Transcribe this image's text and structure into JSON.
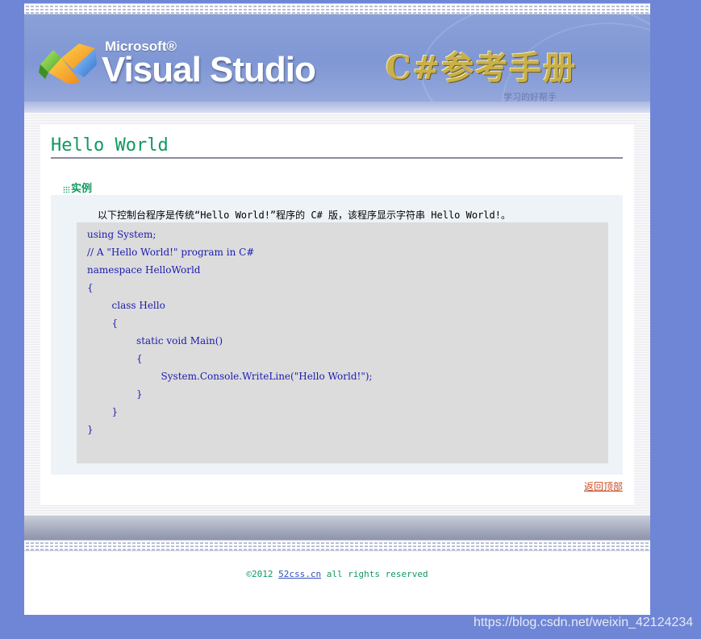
{
  "header": {
    "ms_label": "Microsoft®",
    "product_label": "Visual Studio",
    "manual_title": "C#参考手册",
    "tagline": "学习的好帮手"
  },
  "main": {
    "page_title": "Hello World",
    "section_title": "实例",
    "description": "以下控制台程序是传统“Hello World!”程序的 C# 版，该程序显示字符串 Hello World!。",
    "code_lines": [
      "using System;",
      "// A \"Hello World!\" program in C#",
      "namespace HelloWorld",
      "{",
      "        class Hello",
      "        {",
      "                static void Main()",
      "                {",
      "                        System.Console.WriteLine(\"Hello World!\");",
      "                }",
      "        }",
      "}"
    ],
    "back_to_top": "返回顶部"
  },
  "footer": {
    "copyright_prefix": "©2012 ",
    "site_link": "52css.cn",
    "copyright_suffix": " all rights reserved"
  },
  "watermark": "https://blog.csdn.net/weixin_42124234",
  "colors": {
    "accent_green": "#109960",
    "link_orange": "#cc4a22",
    "code_blue": "#1b1bb0",
    "page_background": "#6f86d6"
  }
}
